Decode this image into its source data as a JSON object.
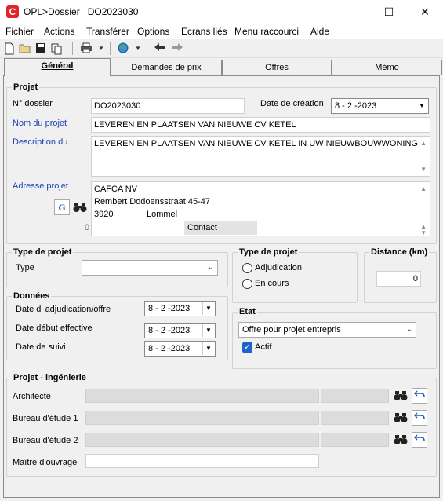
{
  "window": {
    "title_app": "OPL>Dossier",
    "title_doc": "DO2023030",
    "minimize": "—",
    "maximize": "☐",
    "close": "✕",
    "app_letter": "C"
  },
  "menu": [
    "Fichier",
    "Actions",
    "Transférer",
    "Options",
    "Ecrans liés",
    "Menu raccourci",
    "Aide"
  ],
  "tabs": [
    "Général",
    "Demandes de prix",
    "Offres",
    "Mémo"
  ],
  "projet": {
    "group_title": "Projet",
    "dossier_label": "N°  dossier",
    "dossier_value": "DO2023030",
    "date_creation_label": "Date de création",
    "date_creation_value": "8 - 2 -2023",
    "nom_label": "Nom du projet",
    "nom_value": "LEVEREN EN PLAATSEN VAN NIEUWE CV KETEL",
    "description_label": "Description du",
    "description_value": "LEVEREN EN PLAATSEN VAN NIEUWE CV KETEL IN UW NIEUWBOUWWONING",
    "adresse_label": "Adresse projet",
    "adresse_line1": "CAFCA NV",
    "adresse_line2": "Rembert Dodoensstraat 45-47",
    "adresse_zip": "3920",
    "adresse_city": "Lommel",
    "adresse_count": "0",
    "contact_label": "Contact"
  },
  "type_projet_left": {
    "group_title": "Type de projet",
    "type_label": "Type",
    "type_value": ""
  },
  "type_projet_right": {
    "group_title": "Type de projet",
    "option1": "Adjudication",
    "option2": "En cours"
  },
  "distance": {
    "group_title": "Distance (km)",
    "value": "0"
  },
  "donnees": {
    "group_title": "Données",
    "adjudication_label": "Date d' adjudication/offre",
    "adjudication_value": "8 - 2 -2023",
    "debut_label": "Date début effective",
    "debut_value": "8 - 2 -2023",
    "suivi_label": "Date de suivi",
    "suivi_value": "8 - 2 -2023"
  },
  "etat": {
    "group_title": "Etat",
    "value": "Offre pour projet entrepris",
    "actif_label": "Actif"
  },
  "ingenierie": {
    "group_title": "Projet - ingénierie",
    "architecte_label": "Architecte",
    "bureau1_label": "Bureau d'étude 1",
    "bureau2_label": "Bureau d'étude 2",
    "maitre_label": "Maître d'ouvrage"
  }
}
